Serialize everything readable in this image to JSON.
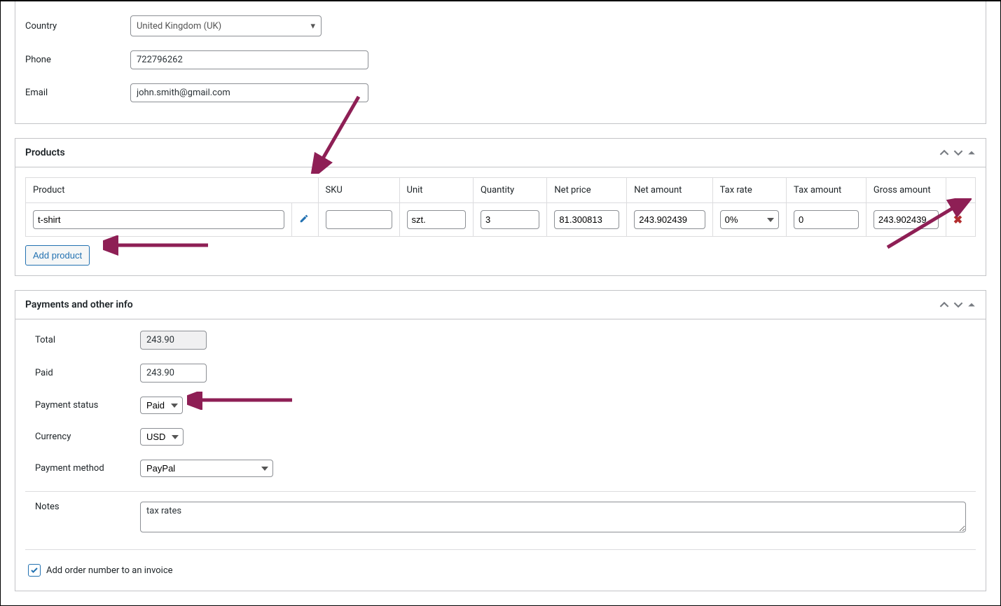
{
  "topFields": {
    "countryLabel": "Country",
    "countryValue": "United Kingdom (UK)",
    "phoneLabel": "Phone",
    "phoneValue": "722796262",
    "emailLabel": "Email",
    "emailValue": "john.smith@gmail.com"
  },
  "products": {
    "title": "Products",
    "headers": {
      "product": "Product",
      "sku": "SKU",
      "unit": "Unit",
      "qty": "Quantity",
      "netPrice": "Net price",
      "netAmount": "Net amount",
      "taxRate": "Tax rate",
      "taxAmount": "Tax amount",
      "gross": "Gross amount"
    },
    "row": {
      "product": "t-shirt",
      "sku": "",
      "unit": "szt.",
      "qty": "3",
      "netPrice": "81.300813",
      "netAmount": "243.902439",
      "taxRate": "0%",
      "taxAmount": "0",
      "gross": "243.902439"
    },
    "addButton": "Add product"
  },
  "payments": {
    "title": "Payments and other info",
    "totalLabel": "Total",
    "totalValue": "243.90",
    "paidLabel": "Paid",
    "paidValue": "243.90",
    "statusLabel": "Payment status",
    "statusValue": "Paid",
    "currencyLabel": "Currency",
    "currencyValue": "USD",
    "methodLabel": "Payment method",
    "methodValue": "PayPal",
    "notesLabel": "Notes",
    "notesValue": "tax rates",
    "checkboxLabel": "Add order number to an invoice"
  }
}
